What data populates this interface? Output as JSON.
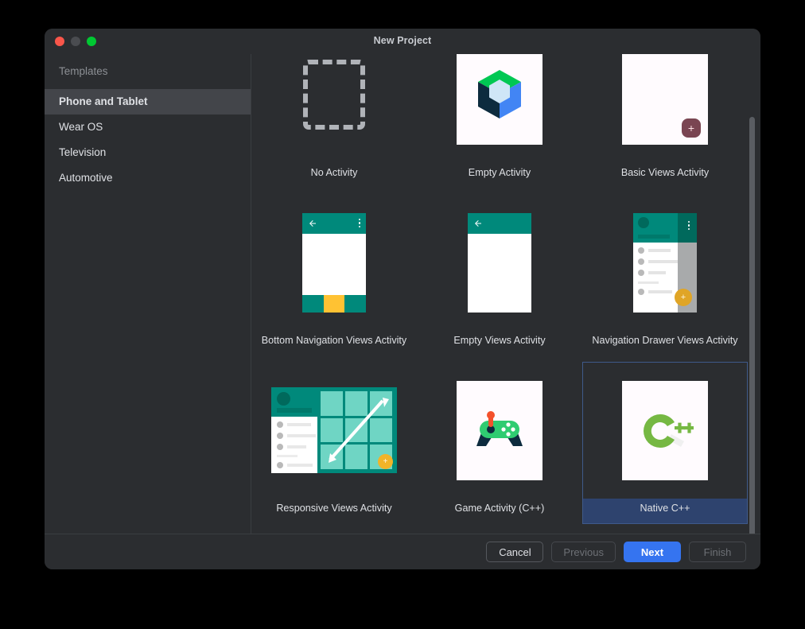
{
  "window": {
    "title": "New Project",
    "traffic_lights": [
      "close-button",
      "minimize-button",
      "zoom-button"
    ]
  },
  "sidebar": {
    "header": "Templates",
    "items": [
      {
        "label": "Phone and Tablet",
        "selected": true
      },
      {
        "label": "Wear OS",
        "selected": false
      },
      {
        "label": "Television",
        "selected": false
      },
      {
        "label": "Automotive",
        "selected": false
      }
    ]
  },
  "templates": {
    "rows": [
      [
        {
          "label": "No Activity",
          "thumb": "dashed-box",
          "selected": false
        },
        {
          "label": "Empty Activity",
          "thumb": "compose-logo",
          "selected": false
        },
        {
          "label": "Basic Views Activity",
          "thumb": "basic-views-fab",
          "selected": false
        }
      ],
      [
        {
          "label": "Bottom Navigation Views Activity",
          "thumb": "bottom-nav",
          "selected": false
        },
        {
          "label": "Empty Views Activity",
          "thumb": "empty-views",
          "selected": false
        },
        {
          "label": "Navigation Drawer Views Activity",
          "thumb": "nav-drawer",
          "selected": false
        }
      ],
      [
        {
          "label": "Responsive Views Activity",
          "thumb": "responsive-views",
          "selected": false
        },
        {
          "label": "Game Activity (C++)",
          "thumb": "gamepad",
          "selected": false
        },
        {
          "label": "Native C++",
          "thumb": "cpp-logo",
          "selected": true
        }
      ]
    ]
  },
  "footer": {
    "cancel": "Cancel",
    "previous": "Previous",
    "next": "Next",
    "finish": "Finish"
  },
  "colors": {
    "window_bg": "#2b2d30",
    "selection_blue": "#2e436e",
    "selection_border": "#3f5a8a",
    "primary_button": "#3574f0",
    "teal": "#00897b",
    "amber": "#ffc233",
    "compose_green": "#00c853",
    "compose_blue": "#4285f4",
    "cpp_green": "#76b843"
  }
}
